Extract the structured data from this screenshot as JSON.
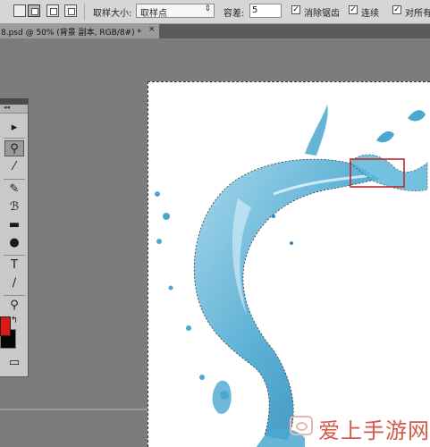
{
  "options_bar": {
    "sample_size_label": "取样大小:",
    "sample_size_value": "取样点",
    "tolerance_label": "容差:",
    "tolerance_value": "5",
    "antialias_label": "消除锯齿",
    "contiguous_label": "连续",
    "sample_all_label": "对所有图"
  },
  "document_tab": {
    "title": "8.psd @ 50% (背景 副本, RGB/8#) *",
    "close_symbol": "×"
  },
  "tools_panel": {
    "collapse_symbol": "◂◂",
    "tools": [
      {
        "name": "move-tool",
        "glyph": "▸"
      },
      {
        "name": "magic-wand-tool",
        "glyph": "⚲"
      },
      {
        "name": "eyedropper-tool",
        "glyph": "⁄"
      },
      {
        "name": "brush-tool",
        "glyph": "✎"
      },
      {
        "name": "history-brush-tool",
        "glyph": "ℬ"
      },
      {
        "name": "gradient-tool",
        "glyph": "▬"
      },
      {
        "name": "dodge-tool",
        "glyph": "●"
      },
      {
        "name": "type-tool",
        "glyph": "T"
      },
      {
        "name": "line-tool",
        "glyph": "∕"
      },
      {
        "name": "zoom-tool",
        "glyph": "⚲"
      },
      {
        "name": "swap-colors",
        "glyph": "↰"
      }
    ],
    "foreground_color": "#e01818",
    "background_color": "#050505",
    "screen_mode_glyph": "▭"
  },
  "watermark": {
    "text": "爱上手游网"
  },
  "colors": {
    "water": "#4aa8d0",
    "selection_box": "#c0282a"
  }
}
